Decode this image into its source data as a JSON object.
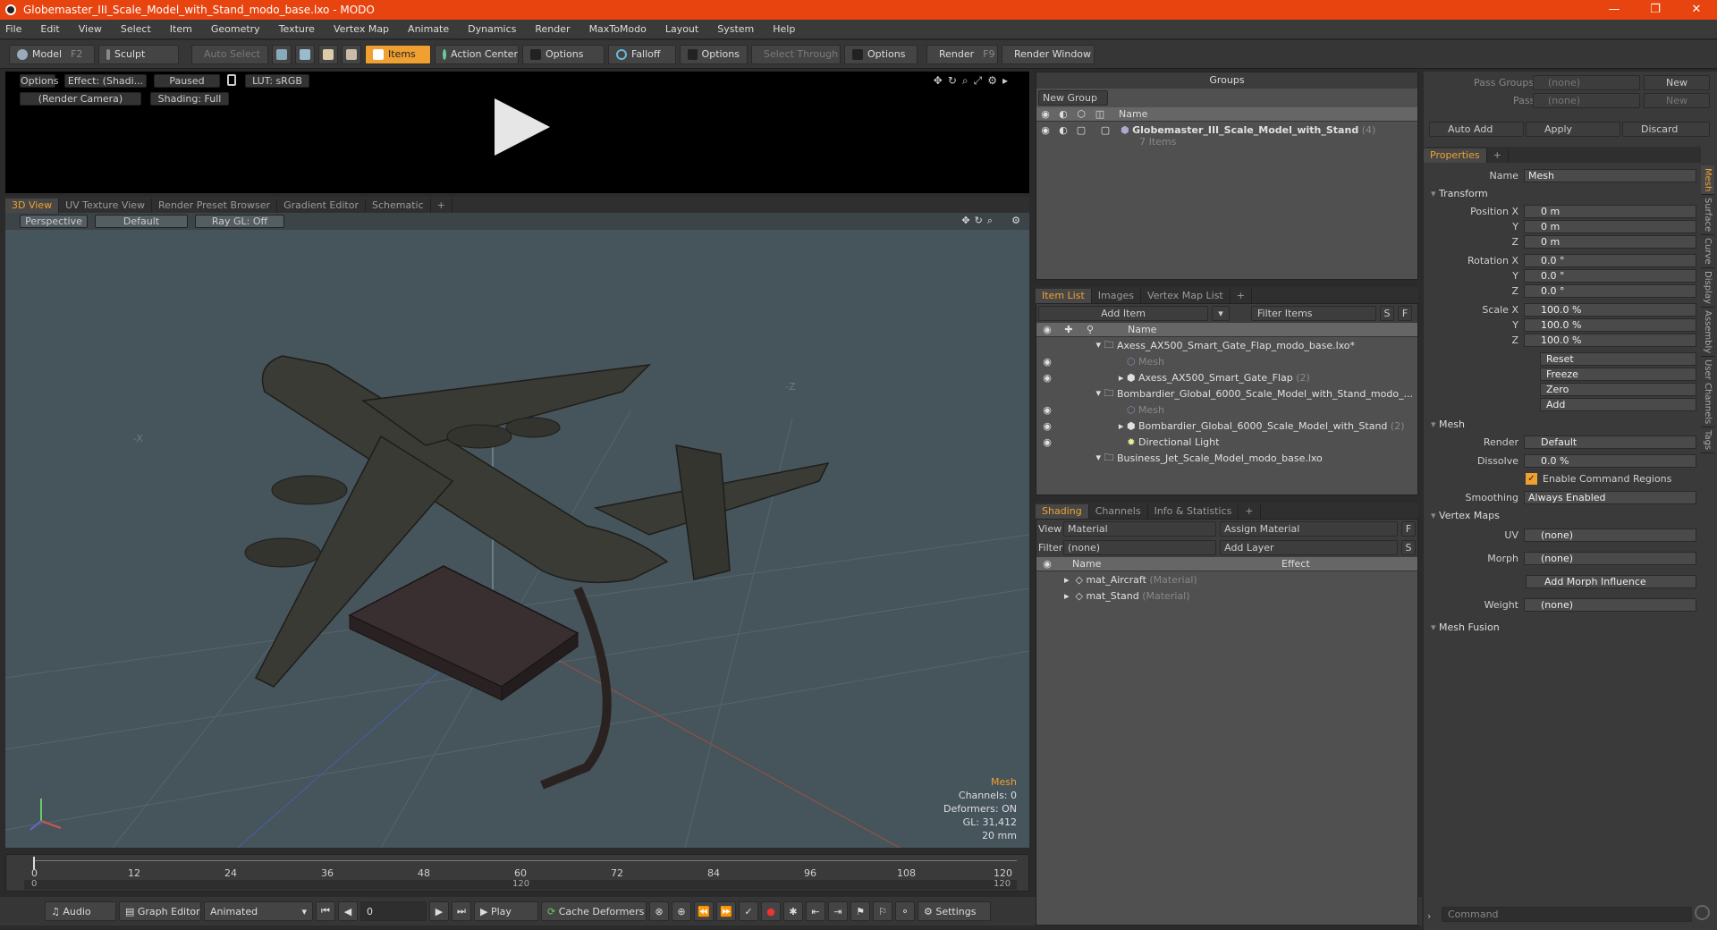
{
  "window": {
    "title": "Globemaster_III_Scale_Model_with_Stand_modo_base.lxo - MODO",
    "minimize": "—",
    "maximize": "❐",
    "close": "✕"
  },
  "menu": [
    "File",
    "Edit",
    "View",
    "Select",
    "Item",
    "Geometry",
    "Texture",
    "Vertex Map",
    "Animate",
    "Dynamics",
    "Render",
    "MaxToModo",
    "Layout",
    "System",
    "Help"
  ],
  "toolbar": {
    "model": "Model",
    "model_key": "F2",
    "sculpt": "Sculpt",
    "auto_select": "Auto Select",
    "items": "Items",
    "action_center": "Action Center",
    "options1": "Options",
    "falloff": "Falloff",
    "options2": "Options",
    "select_through": "Select Through",
    "options3": "Options",
    "render": "Render",
    "render_key": "F9",
    "render_window": "Render Window"
  },
  "preview": {
    "options": "Options",
    "effect": "Effect: (Shadi...",
    "paused": "Paused",
    "lut": "LUT: sRGB",
    "camera": "(Render Camera)",
    "shading": "Shading: Full"
  },
  "view_tabs": [
    "3D View",
    "UV Texture View",
    "Render Preset Browser",
    "Gradient Editor",
    "Schematic",
    "+"
  ],
  "viewport": {
    "perspective": "Perspective",
    "default": "Default",
    "raygl": "Ray GL: Off",
    "axis_x": "-X",
    "axis_z": "-Z",
    "hud": {
      "type": "Mesh",
      "channels": "Channels: 0",
      "deformers": "Deformers: ON",
      "gl": "GL: 31,412",
      "unit": "20 mm"
    }
  },
  "timeline": {
    "ticks": [
      "0",
      "12",
      "24",
      "36",
      "48",
      "60",
      "72",
      "84",
      "96",
      "108",
      "120"
    ],
    "sub_left": "0",
    "sub_mid": "120",
    "sub_right": "120"
  },
  "transport": {
    "audio": "Audio",
    "graph_editor": "Graph Editor",
    "animated": "Animated",
    "frame": "0",
    "play": "Play",
    "cache": "Cache Deformers",
    "settings": "Settings"
  },
  "groups": {
    "title": "Groups",
    "new_group": "New Group",
    "col_name": "Name",
    "item_name": "Globemaster_III_Scale_Model_with_Stand",
    "item_count": "(4)",
    "item_sub": "7 Items"
  },
  "itemlist": {
    "tabs": [
      "Item List",
      "Images",
      "Vertex Map List",
      "+"
    ],
    "add_item": "Add Item",
    "filter": "Filter Items",
    "s": "S",
    "f": "F",
    "col_name": "Name",
    "rows": [
      {
        "label": "Axess_AX500_Smart_Gate_Flap_modo_base.lxo*",
        "indent": 0,
        "dim": ""
      },
      {
        "label": "Mesh",
        "indent": 1,
        "dim": "dim"
      },
      {
        "label": "Axess_AX500_Smart_Gate_Flap",
        "indent": 1,
        "dim": "",
        "count": "(2)"
      },
      {
        "label": "Bombardier_Global_6000_Scale_Model_with_Stand_modo_...",
        "indent": 0,
        "dim": ""
      },
      {
        "label": "Mesh",
        "indent": 1,
        "dim": "dim"
      },
      {
        "label": "Bombardier_Global_6000_Scale_Model_with_Stand",
        "indent": 1,
        "dim": "",
        "count": "(2)"
      },
      {
        "label": "Directional Light",
        "indent": 1,
        "dim": ""
      },
      {
        "label": "Business_Jet_Scale_Model_modo_base.lxo",
        "indent": 0,
        "dim": ""
      }
    ]
  },
  "shading": {
    "tabs": [
      "Shading",
      "Channels",
      "Info & Statistics",
      "+"
    ],
    "view_label": "View",
    "view_value": "Material",
    "assign": "Assign Material",
    "f": "F",
    "filter_label": "Filter",
    "filter_value": "(none)",
    "add_layer": "Add Layer",
    "s": "S",
    "col_name": "Name",
    "col_effect": "Effect",
    "rows": [
      {
        "name": "mat_Aircraft",
        "type": "(Material)"
      },
      {
        "name": "mat_Stand",
        "type": "(Material)"
      }
    ]
  },
  "props": {
    "pass_groups": "Pass Groups",
    "passes": "Passes",
    "none": "(none)",
    "new": "New",
    "auto_add": "Auto Add",
    "apply": "Apply",
    "discard": "Discard",
    "tab": "Properties",
    "plus": "+",
    "name_label": "Name",
    "name_value": "Mesh",
    "transform": "Transform",
    "pos_label": "Position X",
    "y": "Y",
    "z": "Z",
    "pos": [
      "0 m",
      "0 m",
      "0 m"
    ],
    "rot_label": "Rotation X",
    "rot": [
      "0.0 °",
      "0.0 °",
      "0.0 °"
    ],
    "scale_label": "Scale X",
    "scale": [
      "100.0 %",
      "100.0 %",
      "100.0 %"
    ],
    "reset": "Reset",
    "freeze": "Freeze",
    "zero": "Zero",
    "add": "Add",
    "mesh": "Mesh",
    "render_label": "Render",
    "render_value": "Default",
    "dissolve_label": "Dissolve",
    "dissolve_value": "0.0 %",
    "enable_cmd": "Enable Command Regions",
    "smoothing_label": "Smoothing",
    "smoothing_value": "Always Enabled",
    "vertex_maps": "Vertex Maps",
    "uv_label": "UV",
    "morph_label": "Morph",
    "add_morph": "Add Morph Influence",
    "weight_label": "Weight",
    "mesh_fusion": "Mesh Fusion",
    "vtabs": [
      "Mesh",
      "Surface",
      "Curve",
      "Display",
      "Assembly",
      "User Channels",
      "Tags"
    ],
    "command": "Command"
  },
  "colors": {
    "accent": "#f0a030",
    "titlebar": "#e8440f",
    "viewport": "#46545c"
  }
}
